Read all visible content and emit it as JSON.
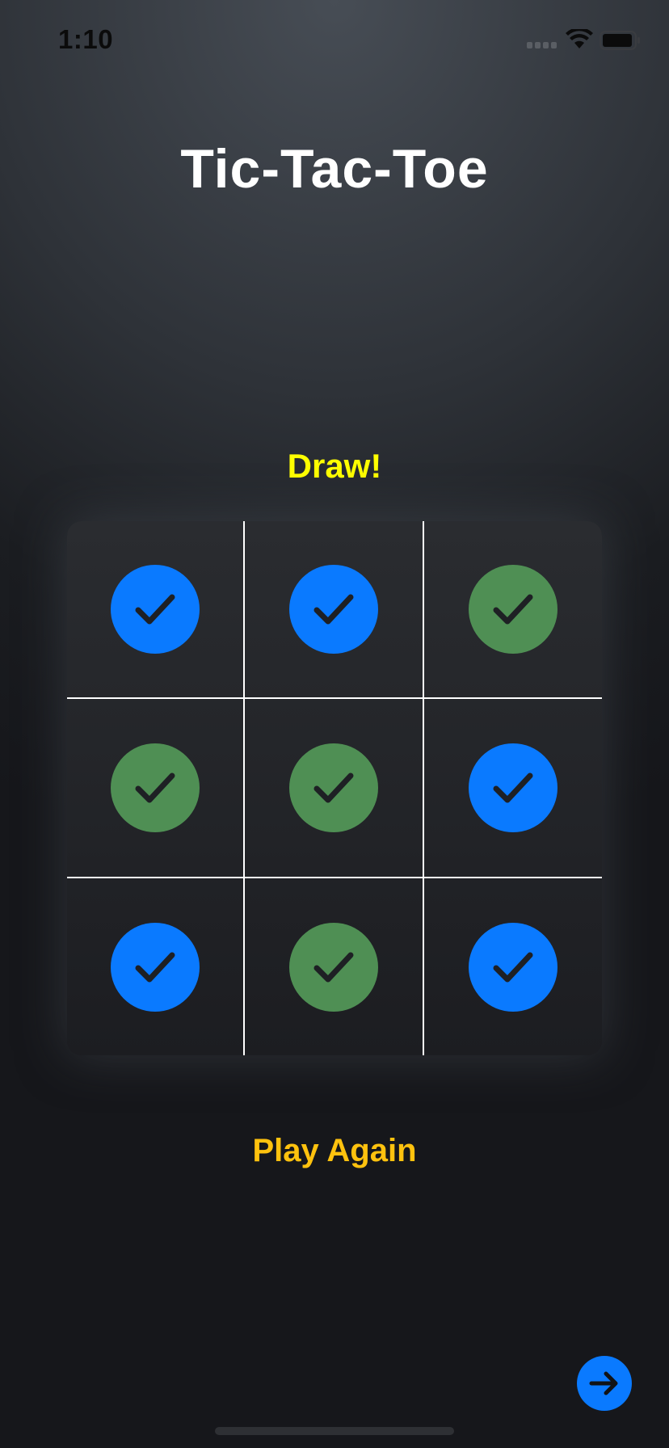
{
  "status_bar": {
    "time": "1:10",
    "icons": [
      "signal-icon",
      "wifi-icon",
      "battery-icon"
    ]
  },
  "title": "Tic-Tac-Toe",
  "game_status": "Draw!",
  "colors": {
    "status": "#ffff00",
    "play_again": "#ffc20e",
    "player_blue": "#0a7aff",
    "player_green": "#4f8f54",
    "checkmark": "#1e2024",
    "grid_lines": "#ffffff",
    "next_button": "#0a7aff"
  },
  "board": {
    "cells": [
      {
        "player": "blue",
        "icon": "checkmark-icon"
      },
      {
        "player": "blue",
        "icon": "checkmark-icon"
      },
      {
        "player": "green",
        "icon": "checkmark-icon"
      },
      {
        "player": "green",
        "icon": "checkmark-icon"
      },
      {
        "player": "green",
        "icon": "checkmark-icon"
      },
      {
        "player": "blue",
        "icon": "checkmark-icon"
      },
      {
        "player": "blue",
        "icon": "checkmark-icon"
      },
      {
        "player": "green",
        "icon": "checkmark-icon"
      },
      {
        "player": "blue",
        "icon": "checkmark-icon"
      }
    ]
  },
  "play_again_label": "Play Again",
  "next_button_icon": "arrow-right-icon"
}
